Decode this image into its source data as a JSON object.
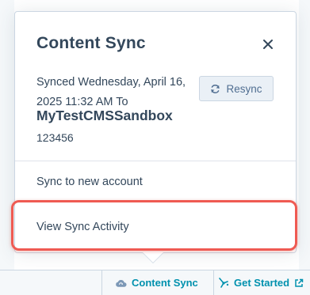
{
  "popover": {
    "title": "Content Sync",
    "synced_text": "Synced Wednesday, April 16, 2025 11:32 AM To",
    "account_name": "MyTestCMSSandbox",
    "account_id": "123456",
    "resync_label": "Resync",
    "menu": {
      "sync_new_account": "Sync to new account",
      "view_sync_activity": "View Sync Activity"
    }
  },
  "bottom_bar": {
    "content_sync_label": "Content Sync",
    "get_started_label": "Get Started"
  },
  "colors": {
    "highlight": "#ef5a52",
    "link": "#0091ae",
    "text": "#33475b"
  },
  "icons": {
    "close": "close-icon",
    "resync": "refresh-icon",
    "content_sync": "cloud-sync-icon",
    "get_started": "sparkle-icon",
    "external": "external-link-icon"
  }
}
